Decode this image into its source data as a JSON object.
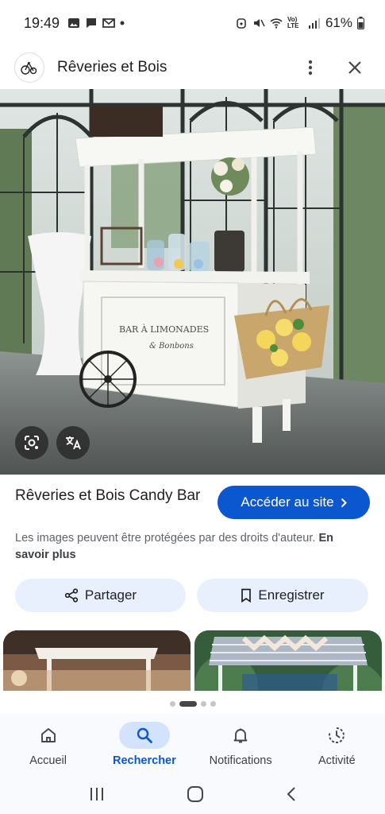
{
  "status_bar": {
    "time": "19:49",
    "battery": "61%",
    "network": "Vo) LTE"
  },
  "header": {
    "title": "Rêveries et Bois"
  },
  "result": {
    "title": "Rêveries et Bois Candy Bar",
    "visit_label": "Accéder au site",
    "copyright_text": "Les images peuvent être protégées par des droits d'auteur.",
    "learn_more": "En savoir plus",
    "share_label": "Partager",
    "save_label": "Enregistrer"
  },
  "image": {
    "sign_line1": "BAR À LIMONADES",
    "sign_line2": "& Bonbons"
  },
  "bottom_nav": {
    "items": [
      {
        "label": "Accueil",
        "icon": "home-icon"
      },
      {
        "label": "Rechercher",
        "icon": "search-icon"
      },
      {
        "label": "Notifications",
        "icon": "bell-icon"
      },
      {
        "label": "Activité",
        "icon": "activity-icon"
      }
    ],
    "active": "Rechercher"
  },
  "colors": {
    "accent": "#0b57d0",
    "chip_bg": "#e8f0fe",
    "nav_active_bg": "#d3e3fd"
  }
}
